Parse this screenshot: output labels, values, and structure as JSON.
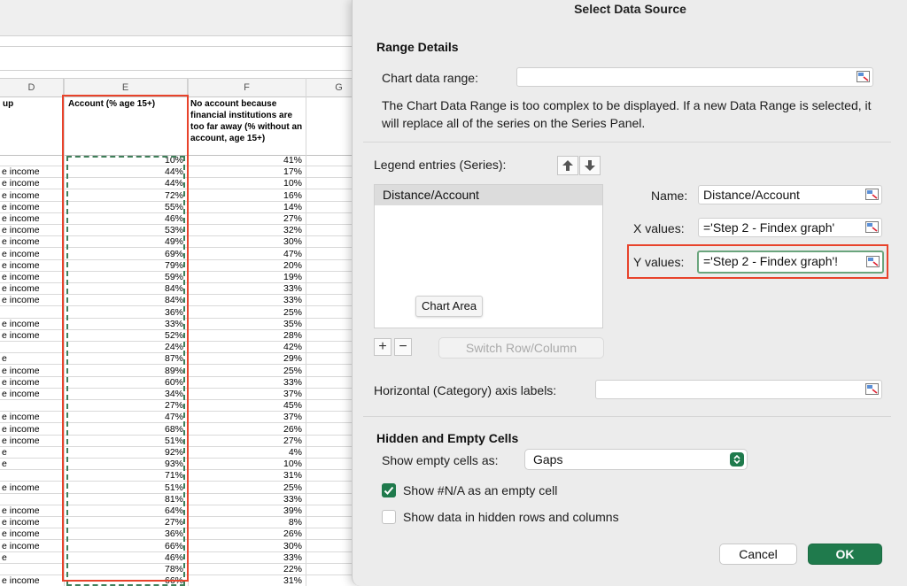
{
  "spreadsheet": {
    "col_headers": [
      "D",
      "E",
      "F",
      "G"
    ],
    "header_row": {
      "d": "up",
      "e": "Account (% age 15+)",
      "f": "No account because financial institutions are too far away (% without an account, age 15+)"
    },
    "rows": [
      {
        "d": "",
        "e": "10%",
        "f": "41%"
      },
      {
        "d": "e income",
        "e": "44%",
        "f": "17%"
      },
      {
        "d": "e income",
        "e": "44%",
        "f": "10%"
      },
      {
        "d": "e income",
        "e": "72%",
        "f": "16%"
      },
      {
        "d": "e income",
        "e": "55%",
        "f": "14%"
      },
      {
        "d": "e income",
        "e": "46%",
        "f": "27%"
      },
      {
        "d": "e income",
        "e": "53%",
        "f": "32%"
      },
      {
        "d": "e income",
        "e": "49%",
        "f": "30%"
      },
      {
        "d": "e income",
        "e": "69%",
        "f": "47%"
      },
      {
        "d": "e income",
        "e": "79%",
        "f": "20%"
      },
      {
        "d": "e income",
        "e": "59%",
        "f": "19%"
      },
      {
        "d": "e income",
        "e": "84%",
        "f": "33%"
      },
      {
        "d": "e income",
        "e": "84%",
        "f": "33%"
      },
      {
        "d": "",
        "e": "36%",
        "f": "25%"
      },
      {
        "d": "e income",
        "e": "33%",
        "f": "35%"
      },
      {
        "d": "e income",
        "e": "52%",
        "f": "28%"
      },
      {
        "d": "",
        "e": "24%",
        "f": "42%"
      },
      {
        "d": "e",
        "e": "87%",
        "f": "29%"
      },
      {
        "d": "e income",
        "e": "89%",
        "f": "25%"
      },
      {
        "d": "e income",
        "e": "60%",
        "f": "33%"
      },
      {
        "d": "e income",
        "e": "34%",
        "f": "37%"
      },
      {
        "d": "",
        "e": "27%",
        "f": "45%"
      },
      {
        "d": "e income",
        "e": "47%",
        "f": "37%"
      },
      {
        "d": "e income",
        "e": "68%",
        "f": "26%"
      },
      {
        "d": "e income",
        "e": "51%",
        "f": "27%"
      },
      {
        "d": "e",
        "e": "92%",
        "f": "4%"
      },
      {
        "d": "e",
        "e": "93%",
        "f": "10%"
      },
      {
        "d": "",
        "e": "71%",
        "f": "31%"
      },
      {
        "d": "e income",
        "e": "51%",
        "f": "25%"
      },
      {
        "d": "",
        "e": "81%",
        "f": "33%"
      },
      {
        "d": "e income",
        "e": "64%",
        "f": "39%"
      },
      {
        "d": "e income",
        "e": "27%",
        "f": "8%"
      },
      {
        "d": "e income",
        "e": "36%",
        "f": "26%"
      },
      {
        "d": "e income",
        "e": "66%",
        "f": "30%"
      },
      {
        "d": "e",
        "e": "46%",
        "f": "33%"
      },
      {
        "d": "",
        "e": "78%",
        "f": "22%"
      },
      {
        "d": "e income",
        "e": "66%",
        "f": "31%"
      }
    ]
  },
  "dialog": {
    "title": "Select Data Source",
    "range_details": {
      "heading": "Range Details",
      "chart_range_label": "Chart data range:",
      "chart_range_value": "",
      "info": "The Chart Data Range is too complex to be displayed. If a new Data Range is selected, it will replace all of the series on the Series Panel."
    },
    "legend_label": "Legend entries (Series):",
    "series": [
      "Distance/Account"
    ],
    "tooltip": "Chart Area",
    "add_label": "+",
    "remove_label": "−",
    "switch_label": "Switch Row/Column",
    "name_label": "Name:",
    "name_value": "Distance/Account",
    "x_label": "X values:",
    "x_value": "='Step 2 - Findex graph'",
    "y_label": "Y values:",
    "y_value": "='Step 2 - Findex graph'!",
    "category_label": "Horizontal (Category) axis labels:",
    "category_value": "",
    "hidden": {
      "heading": "Hidden and Empty Cells",
      "show_empty_label": "Show empty cells as:",
      "show_empty_value": "Gaps",
      "na_label": "Show #N/A as an empty cell",
      "na_checked": true,
      "hidden_rows_label": "Show data in hidden rows and columns",
      "hidden_rows_checked": false
    },
    "cancel_label": "Cancel",
    "ok_label": "OK"
  },
  "colors": {
    "accent_green": "#1f7a4c",
    "highlight_red": "#e8432b",
    "selection_dash": "#3f7f5a"
  }
}
